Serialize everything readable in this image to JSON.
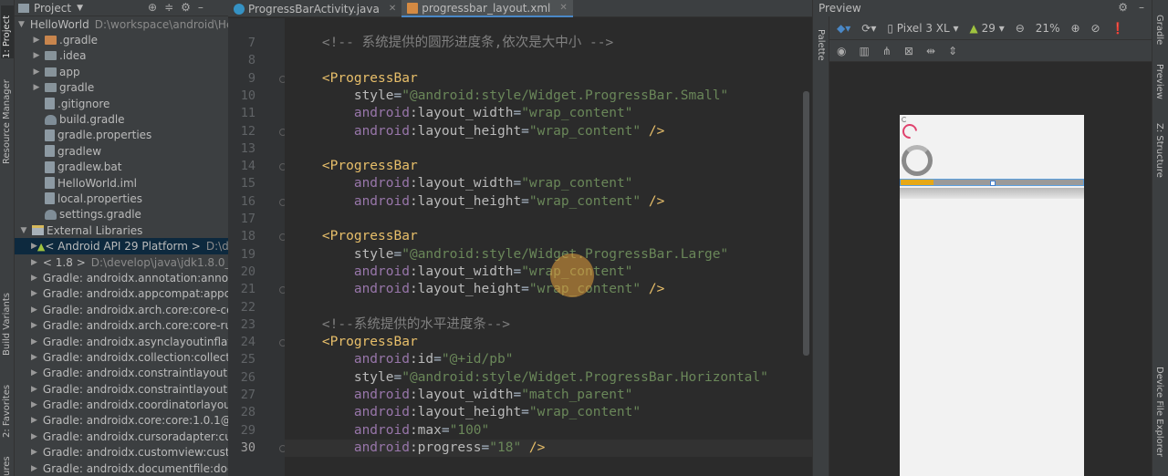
{
  "left_strip": {
    "project_tab": "1: Project",
    "resource_manager_tab": "Resource Manager",
    "build_variants_tab": "Build Variants",
    "favorites_tab": "2: Favorites",
    "structure_tab": "ures"
  },
  "project_panel": {
    "title": "Project",
    "tree": [
      {
        "indent": 0,
        "arrow": "▼",
        "icon": "folder",
        "label": "HelloWorld",
        "extra": "D:\\workspace\\android\\Hell"
      },
      {
        "indent": 1,
        "arrow": "▶",
        "icon": "folder-orange",
        "label": ".gradle",
        "extra": ""
      },
      {
        "indent": 1,
        "arrow": "▶",
        "icon": "folder",
        "label": ".idea",
        "extra": ""
      },
      {
        "indent": 1,
        "arrow": "▶",
        "icon": "folder",
        "label": "app",
        "extra": ""
      },
      {
        "indent": 1,
        "arrow": "▶",
        "icon": "folder",
        "label": "gradle",
        "extra": ""
      },
      {
        "indent": 1,
        "arrow": "",
        "icon": "file",
        "label": ".gitignore",
        "extra": ""
      },
      {
        "indent": 1,
        "arrow": "",
        "icon": "gradle",
        "label": "build.gradle",
        "extra": ""
      },
      {
        "indent": 1,
        "arrow": "",
        "icon": "file",
        "label": "gradle.properties",
        "extra": ""
      },
      {
        "indent": 1,
        "arrow": "",
        "icon": "file",
        "label": "gradlew",
        "extra": ""
      },
      {
        "indent": 1,
        "arrow": "",
        "icon": "file",
        "label": "gradlew.bat",
        "extra": ""
      },
      {
        "indent": 1,
        "arrow": "",
        "icon": "file",
        "label": "HelloWorld.iml",
        "extra": ""
      },
      {
        "indent": 1,
        "arrow": "",
        "icon": "file",
        "label": "local.properties",
        "extra": ""
      },
      {
        "indent": 1,
        "arrow": "",
        "icon": "gradle",
        "label": "settings.gradle",
        "extra": ""
      },
      {
        "indent": 0,
        "arrow": "▼",
        "icon": "lib",
        "label": "External Libraries",
        "extra": ""
      },
      {
        "indent": 1,
        "arrow": "▶",
        "icon": "android",
        "label": "< Android API 29 Platform >",
        "extra": "D:\\deve",
        "selected": true
      },
      {
        "indent": 1,
        "arrow": "▶",
        "icon": "folder",
        "label": "< 1.8 >",
        "extra": "D:\\develop\\java\\jdk1.8.0_221"
      },
      {
        "indent": 1,
        "arrow": "▶",
        "icon": "lib",
        "label": "Gradle: androidx.annotation:annotat",
        "extra": ""
      },
      {
        "indent": 1,
        "arrow": "▶",
        "icon": "lib",
        "label": "Gradle: androidx.appcompat:appcom",
        "extra": ""
      },
      {
        "indent": 1,
        "arrow": "▶",
        "icon": "lib",
        "label": "Gradle: androidx.arch.core:core-comr",
        "extra": ""
      },
      {
        "indent": 1,
        "arrow": "▶",
        "icon": "lib",
        "label": "Gradle: androidx.arch.core:core-runti",
        "extra": ""
      },
      {
        "indent": 1,
        "arrow": "▶",
        "icon": "lib",
        "label": "Gradle: androidx.asynclayoutinflater:a",
        "extra": ""
      },
      {
        "indent": 1,
        "arrow": "▶",
        "icon": "lib",
        "label": "Gradle: androidx.collection:collection",
        "extra": ""
      },
      {
        "indent": 1,
        "arrow": "▶",
        "icon": "lib",
        "label": "Gradle: androidx.constraintlayout:cor",
        "extra": ""
      },
      {
        "indent": 1,
        "arrow": "▶",
        "icon": "lib",
        "label": "Gradle: androidx.constraintlayout:cor",
        "extra": ""
      },
      {
        "indent": 1,
        "arrow": "▶",
        "icon": "lib",
        "label": "Gradle: androidx.coordinatorlayout:co",
        "extra": ""
      },
      {
        "indent": 1,
        "arrow": "▶",
        "icon": "lib",
        "label": "Gradle: androidx.core:core:1.0.1@aar",
        "extra": ""
      },
      {
        "indent": 1,
        "arrow": "▶",
        "icon": "lib",
        "label": "Gradle: androidx.cursoradapter:curso",
        "extra": ""
      },
      {
        "indent": 1,
        "arrow": "▶",
        "icon": "lib",
        "label": "Gradle: androidx.customview:custom",
        "extra": ""
      },
      {
        "indent": 1,
        "arrow": "▶",
        "icon": "lib",
        "label": "Gradle: androidx.documentfile:docur",
        "extra": ""
      }
    ]
  },
  "tabs": [
    {
      "label": "ProgressBarActivity.java",
      "type": "java",
      "active": false
    },
    {
      "label": "progressbar_layout.xml",
      "type": "xml",
      "active": true
    }
  ],
  "editor": {
    "current_line": 30,
    "lines": [
      {
        "n": "7",
        "tokens": [
          [
            "ind",
            "    "
          ],
          [
            "comment",
            "<!-- 系统提供的圆形进度条,依次是大中小 -->"
          ]
        ]
      },
      {
        "n": "8",
        "tokens": []
      },
      {
        "n": "9",
        "tokens": [
          [
            "ind",
            "    "
          ],
          [
            "tag",
            "<ProgressBar"
          ]
        ],
        "fold": true
      },
      {
        "n": "10",
        "tokens": [
          [
            "ind",
            "        "
          ],
          [
            "attr",
            "style"
          ],
          [
            "plain",
            "="
          ],
          [
            "val",
            "\"@android:style/Widget.ProgressBar.Small\""
          ]
        ]
      },
      {
        "n": "11",
        "tokens": [
          [
            "ind",
            "        "
          ],
          [
            "ns",
            "android"
          ],
          [
            "attr",
            ":layout_width"
          ],
          [
            "plain",
            "="
          ],
          [
            "val",
            "\"wrap_content\""
          ]
        ]
      },
      {
        "n": "12",
        "tokens": [
          [
            "ind",
            "        "
          ],
          [
            "ns",
            "android"
          ],
          [
            "attr",
            ":layout_height"
          ],
          [
            "plain",
            "="
          ],
          [
            "val",
            "\"wrap_content\""
          ],
          [
            "tag",
            " />"
          ]
        ],
        "fold": true
      },
      {
        "n": "13",
        "tokens": []
      },
      {
        "n": "14",
        "tokens": [
          [
            "ind",
            "    "
          ],
          [
            "tag",
            "<ProgressBar"
          ]
        ],
        "fold": true
      },
      {
        "n": "15",
        "tokens": [
          [
            "ind",
            "        "
          ],
          [
            "ns",
            "android"
          ],
          [
            "attr",
            ":layout_width"
          ],
          [
            "plain",
            "="
          ],
          [
            "val",
            "\"wrap_content\""
          ]
        ]
      },
      {
        "n": "16",
        "tokens": [
          [
            "ind",
            "        "
          ],
          [
            "ns",
            "android"
          ],
          [
            "attr",
            ":layout_height"
          ],
          [
            "plain",
            "="
          ],
          [
            "val",
            "\"wrap_content\""
          ],
          [
            "tag",
            " />"
          ]
        ],
        "fold": true
      },
      {
        "n": "17",
        "tokens": []
      },
      {
        "n": "18",
        "tokens": [
          [
            "ind",
            "    "
          ],
          [
            "tag",
            "<ProgressBar"
          ]
        ],
        "fold": true
      },
      {
        "n": "19",
        "tokens": [
          [
            "ind",
            "        "
          ],
          [
            "attr",
            "style"
          ],
          [
            "plain",
            "="
          ],
          [
            "val",
            "\"@android:style/Widget.ProgressBar.Large\""
          ]
        ]
      },
      {
        "n": "20",
        "tokens": [
          [
            "ind",
            "        "
          ],
          [
            "ns",
            "android"
          ],
          [
            "attr",
            ":layout_width"
          ],
          [
            "plain",
            "="
          ],
          [
            "val",
            "\"wrap_content\""
          ]
        ]
      },
      {
        "n": "21",
        "tokens": [
          [
            "ind",
            "        "
          ],
          [
            "ns",
            "android"
          ],
          [
            "attr",
            ":layout_height"
          ],
          [
            "plain",
            "="
          ],
          [
            "val",
            "\"wrap_content\""
          ],
          [
            "tag",
            " />"
          ]
        ],
        "fold": true
      },
      {
        "n": "22",
        "tokens": []
      },
      {
        "n": "23",
        "tokens": [
          [
            "ind",
            "    "
          ],
          [
            "comment",
            "<!--系统提供的水平进度条-->"
          ]
        ]
      },
      {
        "n": "24",
        "tokens": [
          [
            "ind",
            "    "
          ],
          [
            "tag",
            "<ProgressBar"
          ]
        ],
        "fold": true
      },
      {
        "n": "25",
        "tokens": [
          [
            "ind",
            "        "
          ],
          [
            "ns",
            "android"
          ],
          [
            "attr",
            ":id"
          ],
          [
            "plain",
            "="
          ],
          [
            "val",
            "\"@+id/pb\""
          ]
        ]
      },
      {
        "n": "26",
        "tokens": [
          [
            "ind",
            "        "
          ],
          [
            "attr",
            "style"
          ],
          [
            "plain",
            "="
          ],
          [
            "val",
            "\"@android:style/Widget.ProgressBar.Horizontal\""
          ]
        ]
      },
      {
        "n": "27",
        "tokens": [
          [
            "ind",
            "        "
          ],
          [
            "ns",
            "android"
          ],
          [
            "attr",
            ":layout_width"
          ],
          [
            "plain",
            "="
          ],
          [
            "val",
            "\"match_parent\""
          ]
        ]
      },
      {
        "n": "28",
        "tokens": [
          [
            "ind",
            "        "
          ],
          [
            "ns",
            "android"
          ],
          [
            "attr",
            ":layout_height"
          ],
          [
            "plain",
            "="
          ],
          [
            "val",
            "\"wrap_content\""
          ]
        ]
      },
      {
        "n": "29",
        "tokens": [
          [
            "ind",
            "        "
          ],
          [
            "ns",
            "android"
          ],
          [
            "attr",
            ":max"
          ],
          [
            "plain",
            "="
          ],
          [
            "val",
            "\"100\""
          ]
        ]
      },
      {
        "n": "30",
        "tokens": [
          [
            "ind",
            "        "
          ],
          [
            "ns",
            "android"
          ],
          [
            "attr",
            ":progress"
          ],
          [
            "plain",
            "="
          ],
          [
            "val",
            "\"18\""
          ],
          [
            "tag",
            " />"
          ]
        ],
        "fold": true
      }
    ]
  },
  "preview_panel": {
    "title": "Preview",
    "device": "Pixel 3 XL",
    "api": "29",
    "zoom": "21%",
    "palette_tab": "Palette",
    "progress_value": 0.18
  },
  "right_strip": {
    "gradle_tab": "Gradle",
    "preview_tab": "Preview",
    "structure_tab": "Z: Structure",
    "device_file_tab": "Device File Explorer"
  },
  "colors": {
    "accent": "#4a88c7",
    "progress_fill": "#e6a817",
    "spinner": "#e0436e"
  }
}
